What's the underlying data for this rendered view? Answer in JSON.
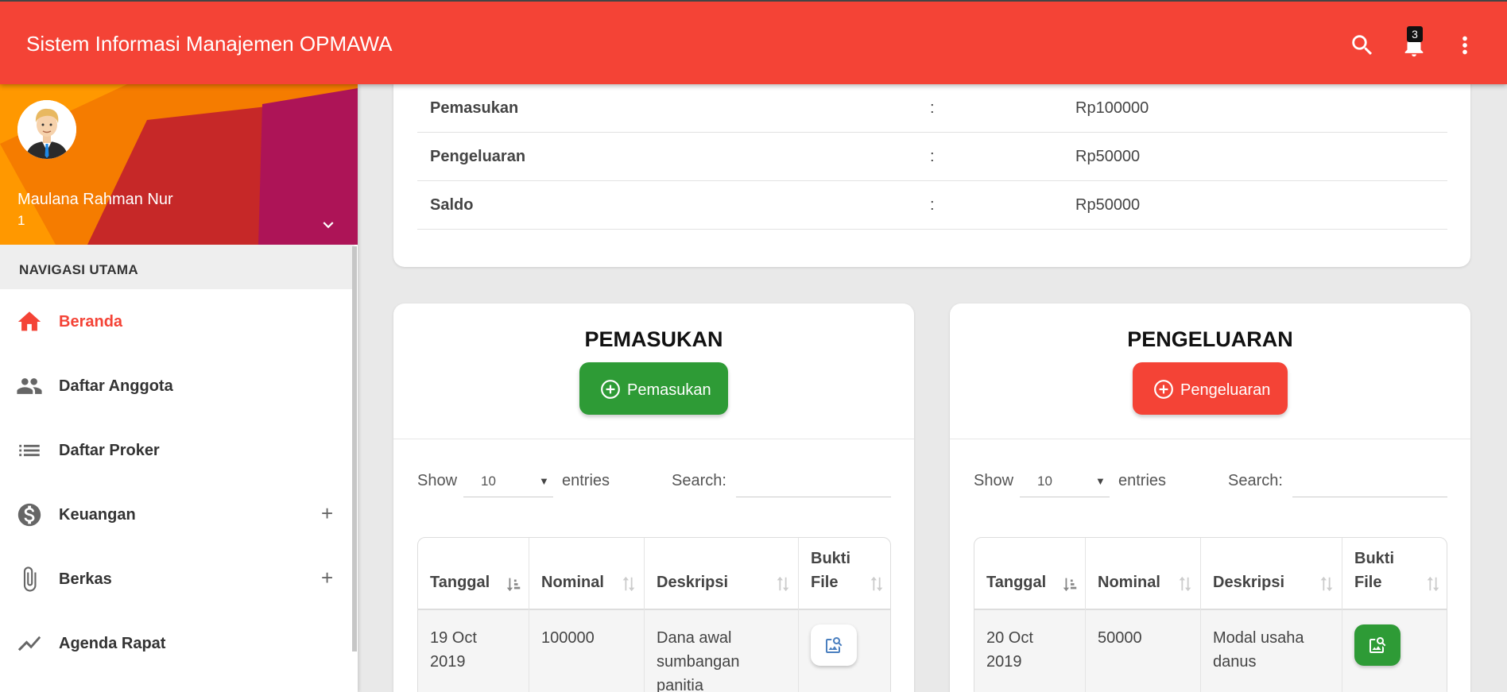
{
  "app": {
    "title": "Sistem Informasi Manajemen OPMAWA"
  },
  "topbar": {
    "notification_count": "3"
  },
  "user": {
    "name": "Maulana Rahman Nur",
    "id": "1"
  },
  "nav": {
    "header": "NAVIGASI UTAMA",
    "items": [
      {
        "label": "Beranda",
        "icon": "home-icon"
      },
      {
        "label": "Daftar Anggota",
        "icon": "people-icon"
      },
      {
        "label": "Daftar Proker",
        "icon": "list-icon"
      },
      {
        "label": "Keuangan",
        "icon": "dollar-icon",
        "expandable": true
      },
      {
        "label": "Berkas",
        "icon": "paperclip-icon",
        "expandable": true
      },
      {
        "label": "Agenda Rapat",
        "icon": "chart-line-icon"
      }
    ]
  },
  "summary": {
    "rows": [
      {
        "label": "Pemasukan",
        "sep": ":",
        "value": "Rp100000"
      },
      {
        "label": "Pengeluaran",
        "sep": ":",
        "value": "Rp50000"
      },
      {
        "label": "Saldo",
        "sep": ":",
        "value": "Rp50000"
      }
    ]
  },
  "pemasukan": {
    "title": "PEMASUKAN",
    "button": "Pemasukan",
    "controls": {
      "show": "Show",
      "length": "10",
      "entries": "entries",
      "search": "Search:"
    },
    "columns": [
      "Tanggal",
      "Nominal",
      "Deskripsi",
      "Bukti File"
    ],
    "rows": [
      {
        "tanggal": "19 Oct 2019",
        "nominal": "100000",
        "deskripsi": "Dana awal sumbangan panitia"
      }
    ]
  },
  "pengeluaran": {
    "title": "PENGELUARAN",
    "button": "Pengeluaran",
    "controls": {
      "show": "Show",
      "length": "10",
      "entries": "entries",
      "search": "Search:"
    },
    "columns": [
      "Tanggal",
      "Nominal",
      "Deskripsi",
      "Bukti File"
    ],
    "rows": [
      {
        "tanggal": "20 Oct 2019",
        "nominal": "50000",
        "deskripsi": "Modal usaha danus"
      }
    ]
  },
  "colors": {
    "primary": "#f44336",
    "success": "#2e9b36",
    "sidebar_bg": "#ffffff",
    "page_bg": "#e9e9e9"
  }
}
